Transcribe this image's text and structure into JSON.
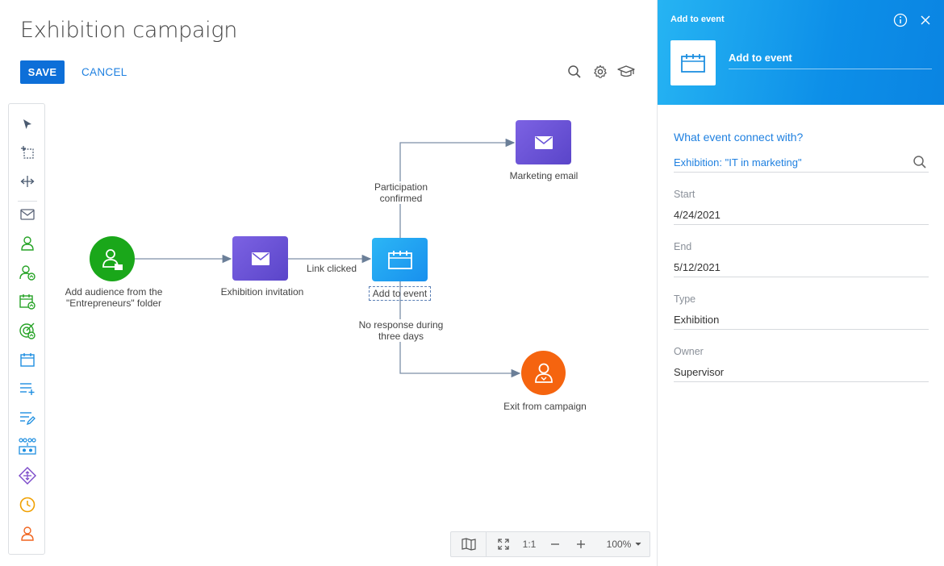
{
  "header": {
    "title": "Exhibition campaign",
    "save_label": "SAVE",
    "cancel_label": "CANCEL"
  },
  "header_icons": [
    "search-icon",
    "gear-icon",
    "graduation-cap-icon"
  ],
  "toolbar": {
    "tools": [
      "pointer-tool-icon",
      "marquee-select-tool-icon",
      "pan-tool-icon",
      "email-element-icon",
      "add-audience-icon",
      "audience-condition-icon",
      "add-to-event-icon",
      "goal-icon",
      "event-icon",
      "add-data-icon",
      "modify-data-icon",
      "split-icon",
      "gateway-icon",
      "timer-icon",
      "exit-campaign-icon"
    ]
  },
  "canvas": {
    "nodes": {
      "audience": {
        "label_line1": "Add audience from the",
        "label_line2": "\"Entrepreneurs\" folder"
      },
      "invitation": {
        "label": "Exhibition invitation"
      },
      "add_event": {
        "label": "Add to event"
      },
      "marketing_email": {
        "label": "Marketing email"
      },
      "exit": {
        "label": "Exit from campaign"
      }
    },
    "edges": {
      "link_clicked": "Link clicked",
      "participation_line1": "Participation",
      "participation_line2": "confirmed",
      "no_response_line1": "No response during",
      "no_response_line2": "three days"
    }
  },
  "zoombar": {
    "one_to_one": "1:1",
    "zoom_level": "100%"
  },
  "panel": {
    "header_title": "Add to event",
    "element_name": "Add to event",
    "question": "What event connect with?",
    "event_lookup": "Exhibition: \"IT in marketing\"",
    "fields": {
      "start_label": "Start",
      "start_value": "4/24/2021",
      "end_label": "End",
      "end_value": "5/12/2021",
      "type_label": "Type",
      "type_value": "Exhibition",
      "owner_label": "Owner",
      "owner_value": "Supervisor"
    }
  },
  "colors": {
    "primary": "#0d6fd8",
    "link": "#1f80e0",
    "audience_green": "#1aa71a",
    "email_purple": "#6a55d8",
    "event_blue": "#1ea0f0",
    "exit_orange": "#f5640f"
  }
}
